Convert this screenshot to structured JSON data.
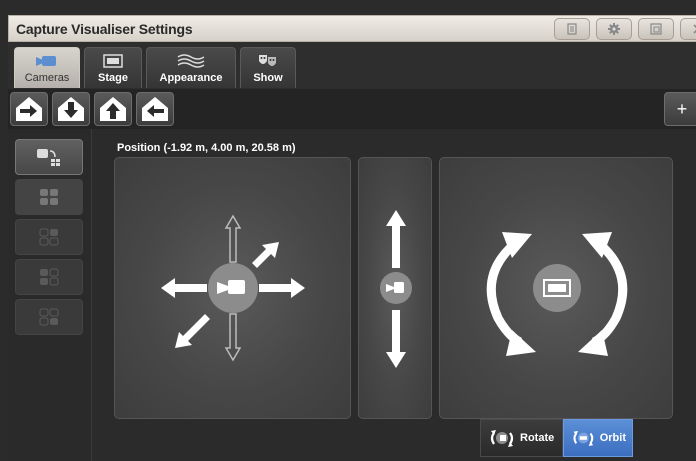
{
  "window": {
    "title": "Capture Visualiser Settings"
  },
  "tabs": [
    {
      "label": "Cameras",
      "icon": "camera-icon",
      "active": true
    },
    {
      "label": "Stage",
      "icon": "stage-icon",
      "active": false
    },
    {
      "label": "Appearance",
      "icon": "waves-icon",
      "active": false
    },
    {
      "label": "Show",
      "icon": "theatre-masks-icon",
      "active": false
    }
  ],
  "toolbar": {
    "plus_label": "+"
  },
  "main": {
    "position_label": "Position (-1.92 m, 4.00 m, 20.58 m)"
  },
  "modes": [
    {
      "label": "Rotate",
      "active": false
    },
    {
      "label": "Orbit",
      "active": true
    }
  ],
  "colors": {
    "accent": "#4a7fd0",
    "arrow": "#ffffff",
    "hub": "#8c8c8c"
  }
}
